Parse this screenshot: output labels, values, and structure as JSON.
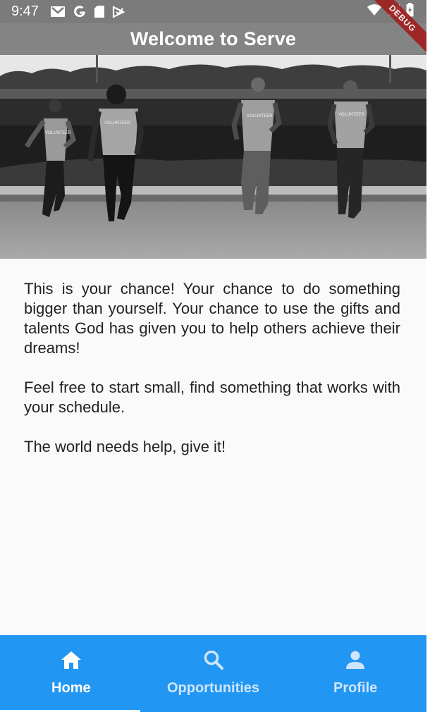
{
  "status_bar": {
    "time": "9:47",
    "left_icons": [
      "gmail-icon",
      "google-icon",
      "sd-card-icon",
      "play-protect-icon"
    ],
    "right_icons": [
      "wifi-icon",
      "signal-icon",
      "battery-charging-icon"
    ]
  },
  "debug_banner": "DEBUG",
  "app_bar": {
    "title": "Welcome to Serve"
  },
  "hero": {
    "image": "volunteers-running-photo",
    "shirt_text": "VOLUNTEER"
  },
  "content": {
    "paragraphs": [
      "This is your chance! Your chance to do something bigger than yourself. Your chance to use the gifts and talents God has given you to help others achieve their dreams!",
      "Feel free to start small, find something that works with your schedule.",
      "The world needs help, give it!"
    ]
  },
  "bottom_nav": {
    "items": [
      {
        "label": "Home",
        "icon": "home-icon",
        "active": true
      },
      {
        "label": "Opportunities",
        "icon": "search-icon",
        "active": false
      },
      {
        "label": "Profile",
        "icon": "person-icon",
        "active": false
      }
    ]
  },
  "colors": {
    "status_bar": "#7b7b7b",
    "app_bar": "#848484",
    "nav_background": "#2196f3",
    "nav_inactive": "#cfe5fb",
    "debug_ribbon": "#a02020"
  }
}
